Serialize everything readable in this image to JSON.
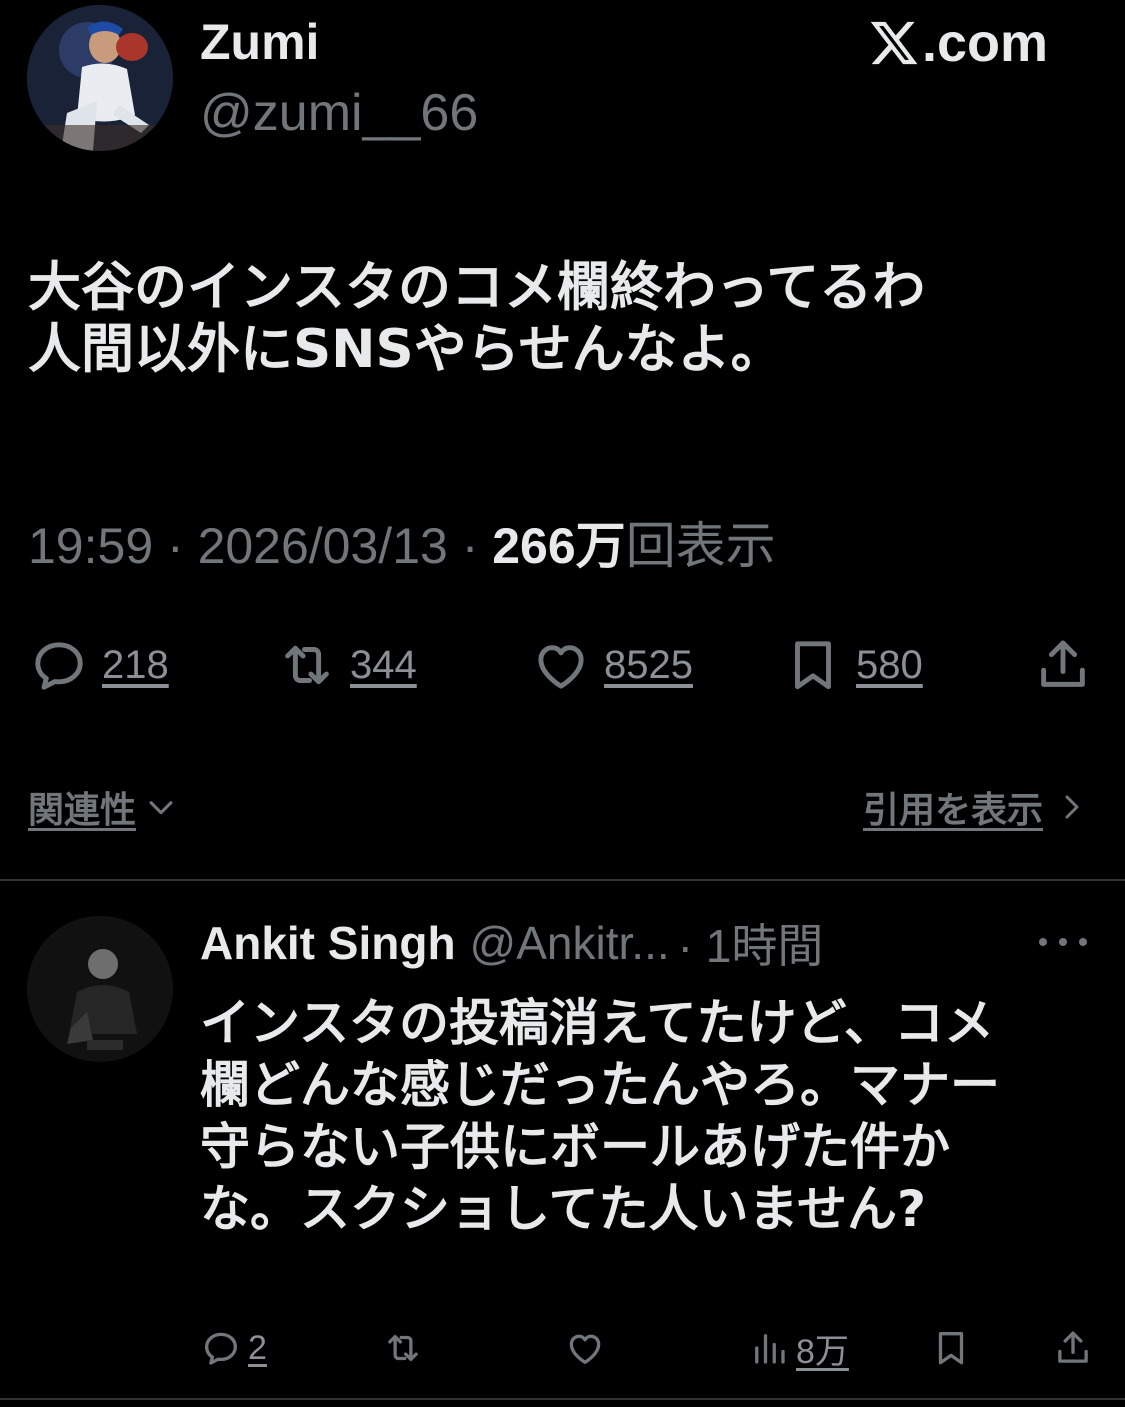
{
  "header": {
    "display_name": "Zumi",
    "handle": "@zumi__66",
    "brand": "X.com"
  },
  "tweet": {
    "lines": [
      "大谷のインスタのコメ欄終わってるわ",
      "人間以外にSNSやらせんなよ。"
    ],
    "time": "19:59",
    "date": "2026/03/13",
    "views_count": "266万",
    "views_label": "回表示",
    "separator": " · "
  },
  "actions": {
    "replies": "218",
    "reposts": "344",
    "likes": "8525",
    "bookmarks": "580"
  },
  "relevance": {
    "label": "関連性"
  },
  "quotes": {
    "label": "引用を表示"
  },
  "reply": {
    "name": "Ankit Singh",
    "handle": "@Ankitr...",
    "time": "· 1時間",
    "lines": [
      "インスタの投稿消えてたけど、コメ",
      "欄どんな感じだったんやろ。マナー",
      "守らない子供にボールあげた件か",
      "な。スクショしてた人いません?"
    ],
    "actions": {
      "replies": "2",
      "views": "8万"
    }
  },
  "colors": {
    "background": "#000000",
    "text_primary": "#e7e9ea",
    "text_secondary": "#71767b",
    "divider": "#2f3336"
  }
}
